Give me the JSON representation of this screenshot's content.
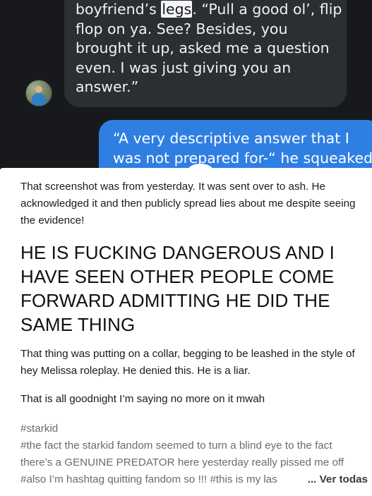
{
  "chat": {
    "incoming_lines": [
      "boyfriend’s ",
      "legs",
      ". “Pull a good ol’, flip",
      "flop on ya. See? Besides, you",
      "brought it up, asked me a question",
      "even. I was just giving you an",
      "answer.”"
    ],
    "outgoing_lines": [
      "“A very descriptive answer that I",
      "was not prepared for-“ he squeaked"
    ]
  },
  "post": {
    "paragraph_1": "That screenshot was from yesterday. It was sent over to ash. He acknowledged it and then publicly spread lies about me despite seeing the evidence!",
    "heading": "HE IS FUCKING DANGEROUS AND I HAVE SEEN OTHER PEOPLE COME FORWARD ADMITTING HE DID THE SAME THING",
    "paragraph_2": "That thing was putting on a collar, begging to be leashed in the style of hey Melissa roleplay. He denied this. He is a liar.",
    "paragraph_3": "That is all goodnight I’m saying no more on it mwah",
    "tags": {
      "tag_1": "#starkid",
      "tag_2_line_1": "#the fact the starkid fandom seemed to turn a blind eye to the fact",
      "tag_2_line_2": "there’s a GENUINE PREDATOR here yesterday really pissed me off",
      "tag_3_line": "#also I’m hashtag quitting fandom so !!!   #this is my las",
      "see_all": "... Ver todas"
    }
  }
}
